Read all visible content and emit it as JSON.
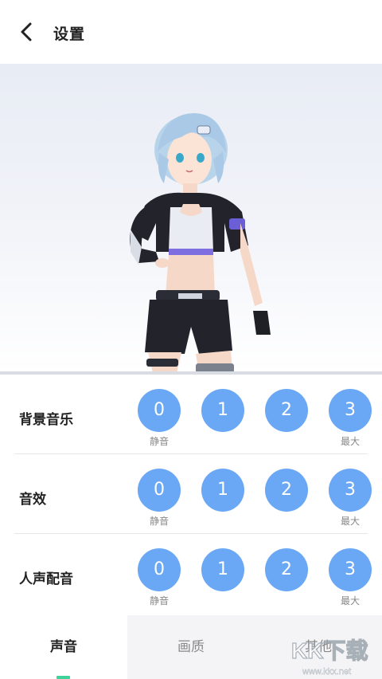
{
  "header": {
    "title": "设置",
    "back_icon": "chevron-left-icon"
  },
  "hero": {
    "description_icon": "character-illustration"
  },
  "settings": [
    {
      "label": "背景音乐",
      "options": [
        "0",
        "1",
        "2",
        "3"
      ],
      "min_label": "静音",
      "max_label": "最大"
    },
    {
      "label": "音效",
      "options": [
        "0",
        "1",
        "2",
        "3"
      ],
      "min_label": "静音",
      "max_label": "最大"
    },
    {
      "label": "人声配音",
      "options": [
        "0",
        "1",
        "2",
        "3"
      ],
      "min_label": "静音",
      "max_label": "最大"
    }
  ],
  "tabs": [
    {
      "label": "声音",
      "active": true
    },
    {
      "label": "画质",
      "active": false
    },
    {
      "label": "其他",
      "active": false
    }
  ],
  "watermark": {
    "text": "KK下载",
    "url_text": "www.kkx.net"
  },
  "colors": {
    "option_bg": "#6aa8f5",
    "indicator": "#3ed39b"
  }
}
